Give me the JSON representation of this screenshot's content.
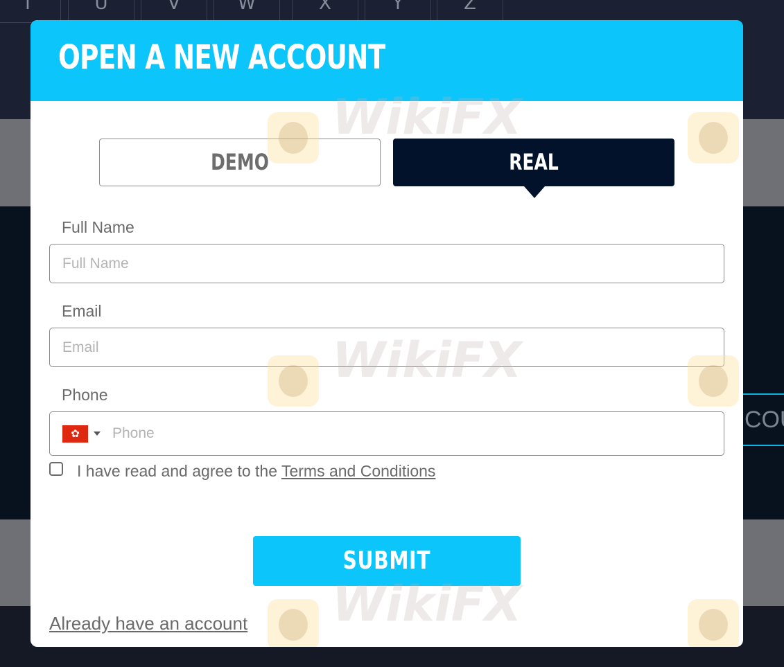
{
  "background": {
    "letter_tabs": [
      "T",
      "U",
      "V",
      "W",
      "X",
      "Y",
      "Z"
    ],
    "side_button_text": "COU"
  },
  "modal": {
    "title": "OPEN A NEW ACCOUNT",
    "tabs": [
      {
        "label": "DEMO",
        "active": false
      },
      {
        "label": "REAL",
        "active": true
      }
    ],
    "fields": {
      "full_name": {
        "label": "Full Name",
        "placeholder": "Full Name",
        "value": ""
      },
      "email": {
        "label": "Email",
        "placeholder": "Email",
        "value": ""
      },
      "phone": {
        "label": "Phone",
        "placeholder": "Phone",
        "value": "",
        "country_flag": "hong-kong-flag"
      }
    },
    "agree": {
      "checked": false,
      "text": "I have read and agree to the ",
      "link_text": "Terms and Conditions"
    },
    "submit_label": "SUBMIT",
    "login_link": "Already have an account"
  },
  "watermark_text": "WikiFX",
  "colors": {
    "header": "#0bc5fb",
    "active_tab": "#02122a",
    "submit": "#0bc5fb"
  }
}
